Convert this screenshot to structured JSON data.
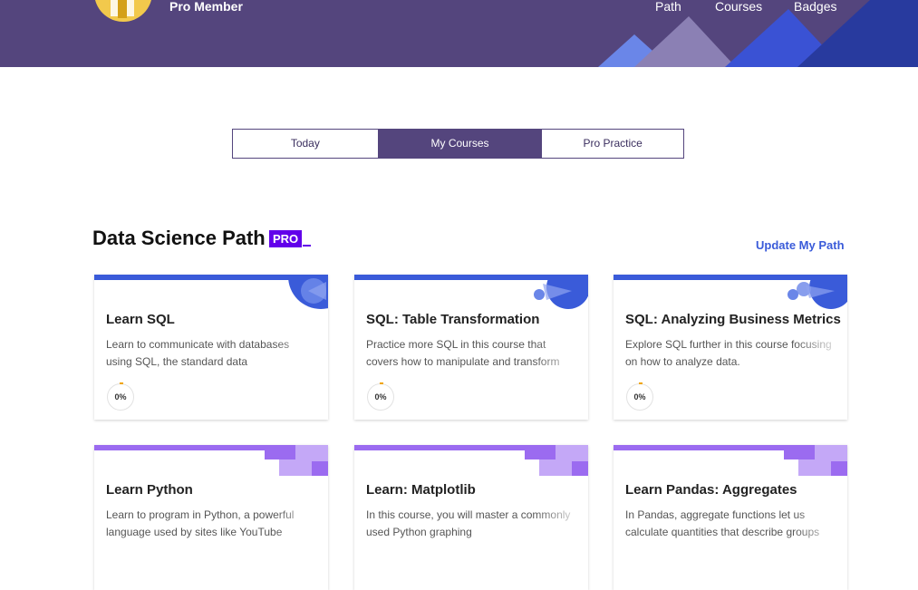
{
  "header": {
    "member_label": "Pro Member",
    "nav": [
      {
        "label": "Path"
      },
      {
        "label": "Courses"
      },
      {
        "label": "Badges"
      }
    ]
  },
  "tabs": [
    {
      "label": "Today",
      "active": false
    },
    {
      "label": "My Courses",
      "active": true
    },
    {
      "label": "Pro Practice",
      "active": false
    }
  ],
  "path": {
    "title": "Data Science Path",
    "badge": "PRO",
    "update_link": "Update My Path"
  },
  "courses": [
    {
      "title": "Learn SQL",
      "description": "Learn to communicate with databases using SQL, the standard data",
      "progress": "0%",
      "theme": "blue"
    },
    {
      "title": "SQL: Table Transformation",
      "description": "Practice more SQL in this course that covers how to manipulate and transform",
      "progress": "0%",
      "theme": "blue"
    },
    {
      "title": "SQL: Analyzing Business Metrics",
      "description": "Explore SQL further in this course focusing on how to analyze data.",
      "progress": "0%",
      "theme": "blue"
    },
    {
      "title": "Learn Python",
      "description": "Learn to program in Python, a powerful language used by sites like YouTube",
      "theme": "purple"
    },
    {
      "title": "Learn: Matplotlib",
      "description": "In this course, you will master a commonly used Python graphing",
      "theme": "purple"
    },
    {
      "title": "Learn Pandas: Aggregates",
      "description": "In Pandas, aggregate functions let us calculate quantities that describe groups",
      "theme": "purple"
    }
  ],
  "colors": {
    "header": "#54457d",
    "accent_blue": "#3a5bd9",
    "accent_purple": "#9b6bf0",
    "pro": "#6200ea"
  }
}
